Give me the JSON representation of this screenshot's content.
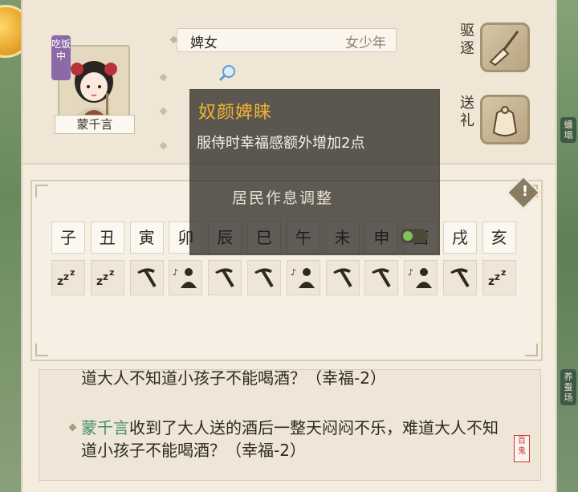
{
  "resident": {
    "name": "蒙千言",
    "role": "婢女",
    "age_group": "女少年",
    "state_tag": "吃饭中"
  },
  "actions": {
    "expel_label": "驱逐",
    "gift_label": "送礼"
  },
  "tooltip": {
    "trait_title": "奴颜婢睐",
    "trait_desc": "服侍时幸福感额外增加2点",
    "section_title": "居民作息调整"
  },
  "schedule": {
    "hours": [
      "子",
      "丑",
      "寅",
      "卯",
      "辰",
      "巳",
      "午",
      "未",
      "申",
      "酉",
      "戌",
      "亥"
    ],
    "activities": [
      "sleep",
      "sleep",
      "work",
      "rest",
      "work",
      "work",
      "rest",
      "work",
      "work",
      "rest",
      "work",
      "sleep"
    ]
  },
  "log": {
    "cut_line": "道大人不知道小孩子不能喝酒？（幸福-2）",
    "entry_name": "蒙千言",
    "entry_text": "收到了大人送的酒后一整天闷闷不乐，难道大人不知道小孩子不能喝酒？（幸福-2）"
  },
  "side_tags": {
    "right_top": "蟠塌",
    "right_bottom": "养蚕场"
  },
  "seal_text": "百鬼",
  "colors": {
    "trait_title": "#f0b434",
    "name_highlight": "#3f8f6a",
    "panel_bg": "#f3ecdf"
  }
}
